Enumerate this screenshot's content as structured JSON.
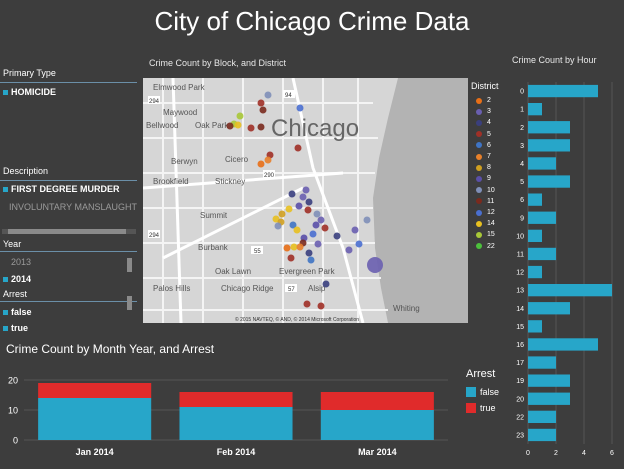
{
  "title": "City of Chicago Crime Data",
  "primary_type": {
    "header": "Primary Type",
    "items": [
      {
        "label": "HOMICIDE",
        "selected": true
      }
    ]
  },
  "description": {
    "header": "Description",
    "items": [
      {
        "label": "FIRST DEGREE MURDER",
        "selected": true
      },
      {
        "label": "INVOLUNTARY MANSLAUGHT",
        "selected": false
      }
    ]
  },
  "year": {
    "header": "Year",
    "items": [
      {
        "label": "2013",
        "selected": false
      },
      {
        "label": "2014",
        "selected": true
      }
    ]
  },
  "arrest_slicer": {
    "header": "Arrest",
    "items": [
      {
        "label": "false",
        "selected": true
      },
      {
        "label": "true",
        "selected": true
      }
    ]
  },
  "map": {
    "title": "Crime Count by Block, and District",
    "city_label": "Chicago",
    "places": [
      "Elmwood Park",
      "Maywood",
      "Bellwood",
      "Oak Park",
      "Berwyn",
      "Cicero",
      "Brookfield",
      "Stickney",
      "Summit",
      "Burbank",
      "Oak Lawn",
      "Evergreen Park",
      "Palos Hills",
      "Chicago Ridge",
      "Alsip",
      "Whiting"
    ],
    "highways": [
      "294",
      "294",
      "94",
      "290",
      "55",
      "57"
    ],
    "copyright": "© 2015 NAVTEQ, © AND, © 2014 Microsoft Corporation",
    "legend_title": "District",
    "districts": [
      {
        "label": "2",
        "color": "#e86f17"
      },
      {
        "label": "3",
        "color": "#6a5fb0"
      },
      {
        "label": "4",
        "color": "#3a3f7e"
      },
      {
        "label": "5",
        "color": "#a03027"
      },
      {
        "label": "6",
        "color": "#3f74c4"
      },
      {
        "label": "7",
        "color": "#e8802a"
      },
      {
        "label": "8",
        "color": "#d0a020"
      },
      {
        "label": "9",
        "color": "#5a4fa8"
      },
      {
        "label": "10",
        "color": "#7f8fb8"
      },
      {
        "label": "11",
        "color": "#7a2a1e"
      },
      {
        "label": "12",
        "color": "#4a6fd0"
      },
      {
        "label": "14",
        "color": "#e8c020"
      },
      {
        "label": "15",
        "color": "#a8c838"
      },
      {
        "label": "22",
        "color": "#4cc03c"
      }
    ]
  },
  "month_chart": {
    "title": "Crime Count by Month Year, and Arrest",
    "legend_title": "Arrest",
    "false_color": "#27a6c9",
    "true_color": "#e02b2b"
  },
  "hour_chart": {
    "title": "Crime Count by Hour"
  },
  "chart_data": [
    {
      "type": "bar",
      "title": "Crime Count by Month Year, and Arrest",
      "categories": [
        "Jan 2014",
        "Feb 2014",
        "Mar 2014"
      ],
      "series": [
        {
          "name": "false",
          "values": [
            14,
            11,
            10
          ]
        },
        {
          "name": "true",
          "values": [
            5,
            5,
            6
          ]
        }
      ],
      "ylim": [
        0,
        20
      ],
      "yticks": [
        0,
        10,
        20
      ],
      "stacked": true,
      "legend": "right"
    },
    {
      "type": "bar",
      "title": "Crime Count by Hour",
      "orientation": "horizontal",
      "categories": [
        "0",
        "1",
        "2",
        "3",
        "4",
        "5",
        "6",
        "9",
        "10",
        "11",
        "12",
        "13",
        "14",
        "15",
        "16",
        "17",
        "19",
        "20",
        "22",
        "23"
      ],
      "values": [
        5,
        1,
        3,
        3,
        2,
        3,
        1,
        2,
        1,
        2,
        1,
        6,
        3,
        1,
        5,
        2,
        3,
        3,
        2,
        2
      ],
      "xlim": [
        0,
        6
      ],
      "xticks": [
        0,
        2,
        4,
        6
      ]
    }
  ]
}
